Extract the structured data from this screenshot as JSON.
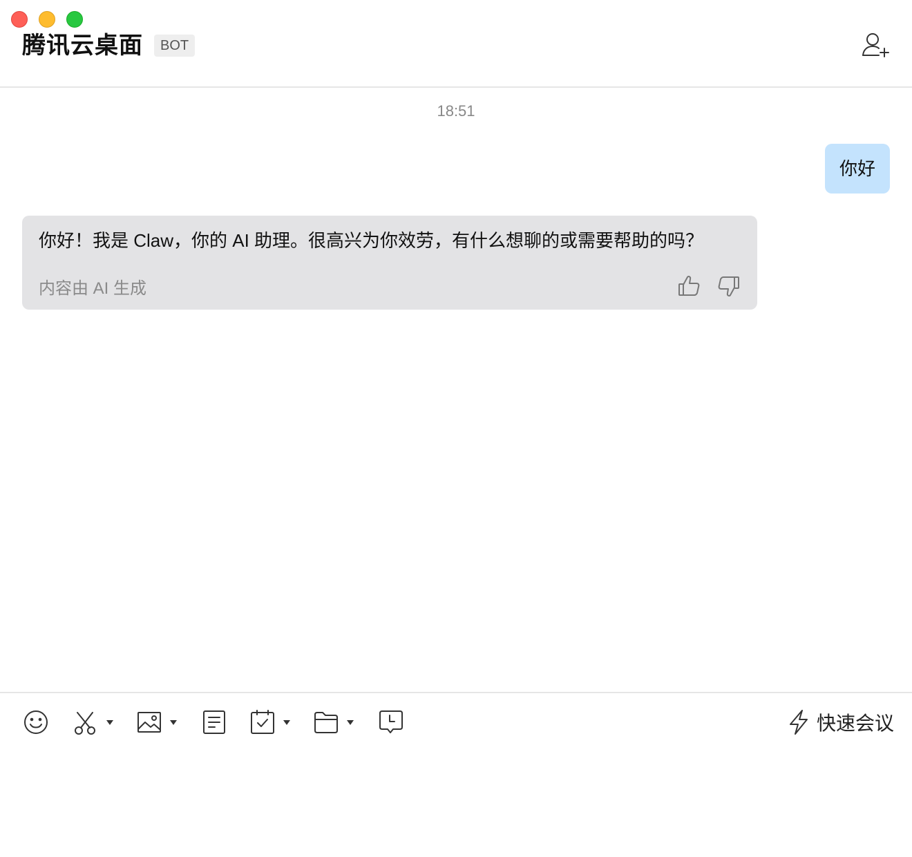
{
  "header": {
    "title": "腾讯云桌面",
    "badge": "BOT"
  },
  "chat": {
    "timestamp": "18:51",
    "messages": [
      {
        "sender": "user",
        "text": "你好"
      },
      {
        "sender": "bot",
        "text": "你好！我是 Claw，你的 AI 助理。很高兴为你效劳，有什么想聊的或需要帮助的吗？",
        "note": "内容由 AI 生成"
      }
    ]
  },
  "toolbar": {
    "icons": [
      "emoji-icon",
      "screenshot-scissors-icon",
      "image-icon",
      "document-icon",
      "task-calendar-icon",
      "folder-icon",
      "chat-history-icon"
    ],
    "quick_meeting_label": "快速会议"
  },
  "colors": {
    "user_bubble": "#c4e3fd",
    "bot_bubble": "#e3e3e5",
    "close": "#fe5f57",
    "minimize": "#febc2e",
    "zoom": "#28c840"
  }
}
